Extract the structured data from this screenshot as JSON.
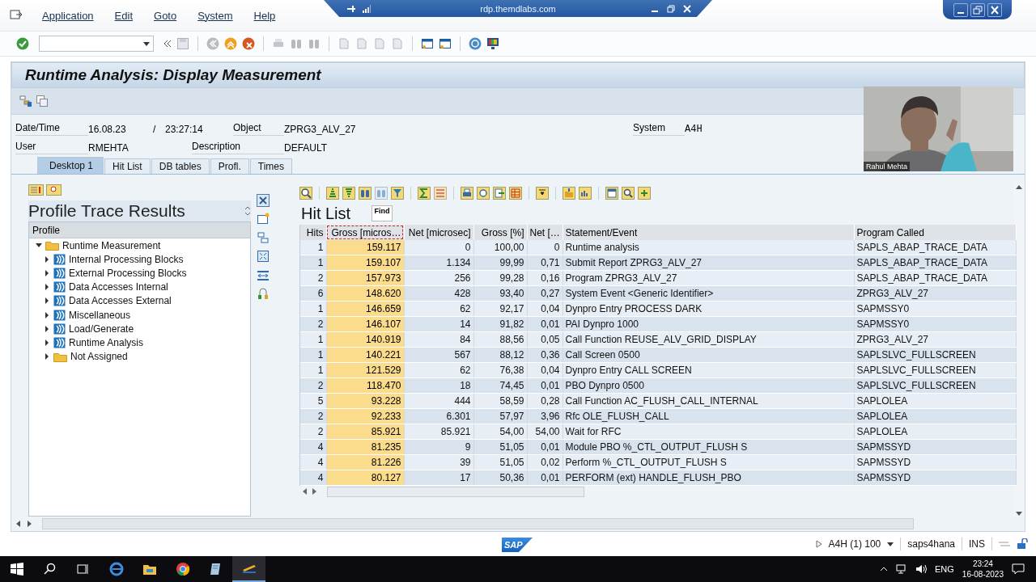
{
  "remote_bar": {
    "title": "rdp.themdlabs.com"
  },
  "menu": [
    "Application",
    "Edit",
    "Goto",
    "System",
    "Help"
  ],
  "title": "Runtime Analysis: Display Measurement",
  "header": {
    "date_label": "Date/Time",
    "date": "16.08.23",
    "separator": "/",
    "time": "23:27:14",
    "object_label": "Object",
    "object": "ZPRG3_ALV_27",
    "system_label": "System",
    "system": "A4H",
    "user_label": "User",
    "user": "RMEHTA",
    "description_label": "Description",
    "description": "DEFAULT"
  },
  "tabs": [
    {
      "label": "Desktop 1",
      "selected": true
    },
    {
      "label": "Hit List",
      "selected": false
    },
    {
      "label": "DB tables",
      "selected": false
    },
    {
      "label": "Profl.",
      "selected": false
    },
    {
      "label": "Times",
      "selected": false
    }
  ],
  "profile_panel": {
    "title": "Profile Trace Results",
    "tree_header": "Profile",
    "items": [
      {
        "label": "Runtime Measurement",
        "kind": "folder",
        "expanded": true,
        "children": [
          {
            "label": "Internal Processing Blocks",
            "kind": "node",
            "expanded": false
          },
          {
            "label": "External Processing Blocks",
            "kind": "node",
            "expanded": false
          },
          {
            "label": "Data Accesses Internal",
            "kind": "node",
            "expanded": false
          },
          {
            "label": "Data Accesses External",
            "kind": "node",
            "expanded": false
          },
          {
            "label": "Miscellaneous",
            "kind": "node",
            "expanded": false
          },
          {
            "label": "Load/Generate",
            "kind": "node",
            "expanded": false
          },
          {
            "label": "Runtime Analysis",
            "kind": "node",
            "expanded": false
          },
          {
            "label": "Not Assigned",
            "kind": "folder",
            "expanded": false
          }
        ]
      }
    ]
  },
  "hit_list": {
    "title": "Hit List",
    "tooltip": "Find",
    "columns": [
      {
        "label": "Hits",
        "selected": false
      },
      {
        "label": "Gross [micros…",
        "selected": true
      },
      {
        "label": "Net [microsec]",
        "selected": false
      },
      {
        "label": "Gross [%]",
        "selected": false
      },
      {
        "label": "Net […",
        "selected": false
      },
      {
        "label": "Statement/Event",
        "selected": false
      },
      {
        "label": "Program Called",
        "selected": false
      }
    ],
    "rows": [
      [
        "1",
        "159.117",
        "0",
        "100,00",
        "0",
        "Runtime analysis",
        "SAPLS_ABAP_TRACE_DATA"
      ],
      [
        "1",
        "159.107",
        "1.134",
        "99,99",
        "0,71",
        "Submit Report ZPRG3_ALV_27",
        "SAPLS_ABAP_TRACE_DATA"
      ],
      [
        "2",
        "157.973",
        "256",
        "99,28",
        "0,16",
        "Program ZPRG3_ALV_27",
        "SAPLS_ABAP_TRACE_DATA"
      ],
      [
        "6",
        "148.620",
        "428",
        "93,40",
        "0,27",
        "System Event <Generic Identifier>",
        "ZPRG3_ALV_27"
      ],
      [
        "1",
        "146.659",
        "62",
        "92,17",
        "0,04",
        "Dynpro Entry PROCESS DARK",
        "SAPMSSY0"
      ],
      [
        "2",
        "146.107",
        "14",
        "91,82",
        "0,01",
        "PAI Dynpro 1000",
        "SAPMSSY0"
      ],
      [
        "1",
        "140.919",
        "84",
        "88,56",
        "0,05",
        "Call Function REUSE_ALV_GRID_DISPLAY",
        "ZPRG3_ALV_27"
      ],
      [
        "1",
        "140.221",
        "567",
        "88,12",
        "0,36",
        "Call Screen 0500",
        "SAPLSLVC_FULLSCREEN"
      ],
      [
        "1",
        "121.529",
        "62",
        "76,38",
        "0,04",
        "Dynpro Entry CALL SCREEN",
        "SAPLSLVC_FULLSCREEN"
      ],
      [
        "2",
        "118.470",
        "18",
        "74,45",
        "0,01",
        "PBO Dynpro 0500",
        "SAPLSLVC_FULLSCREEN"
      ],
      [
        "5",
        "93.228",
        "444",
        "58,59",
        "0,28",
        "Call Function AC_FLUSH_CALL_INTERNAL",
        "SAPLOLEA"
      ],
      [
        "2",
        "92.233",
        "6.301",
        "57,97",
        "3,96",
        "Rfc OLE_FLUSH_CALL",
        "SAPLOLEA"
      ],
      [
        "2",
        "85.921",
        "85.921",
        "54,00",
        "54,00",
        "Wait for RFC",
        "SAPLOLEA"
      ],
      [
        "4",
        "81.235",
        "9",
        "51,05",
        "0,01",
        "Module PBO %_CTL_OUTPUT_FLUSH S",
        "SAPMSSYD"
      ],
      [
        "4",
        "81.226",
        "39",
        "51,05",
        "0,02",
        "Perform %_CTL_OUTPUT_FLUSH S",
        "SAPMSSYD"
      ],
      [
        "4",
        "80.127",
        "17",
        "50,36",
        "0,01",
        "PERFORM (ext) HANDLE_FLUSH_PBO",
        "SAPMSSYD"
      ]
    ]
  },
  "video": {
    "kind": "picture",
    "name": "Rahul Mehta"
  },
  "status_bar": {
    "logo": "SAP",
    "system": "A4H (1) 100",
    "server": "saps4hana",
    "mode": "INS"
  },
  "taskbar": {
    "language": "ENG",
    "time": "23:24",
    "date": "16-08-2023"
  }
}
